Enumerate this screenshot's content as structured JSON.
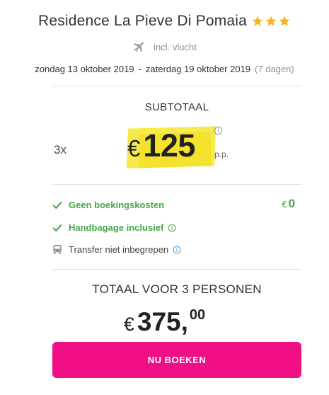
{
  "hotel": {
    "name": "Residence La Pieve Di Pomaia",
    "star_count": 3,
    "star_color": "#f6b526"
  },
  "flight": {
    "icon": "plane-icon",
    "text": "incl. vlucht"
  },
  "dates": {
    "start": "zondag 13 oktober 2019",
    "separator": "-",
    "end": "zaterdag 19 oktober 2019",
    "duration": "(7 dagen)"
  },
  "subtotal": {
    "label": "SUBTOTAAL",
    "count": "3x",
    "currency": "€",
    "price": "125",
    "per_person": "p.p.",
    "highlight_color": "#f7ea4b"
  },
  "features": [
    {
      "icon": "check-icon",
      "label": "Geen boekingskosten",
      "style": "green",
      "has_info": false
    },
    {
      "icon": "check-icon",
      "label": "Handbagage inclusief",
      "style": "green",
      "has_info": true
    },
    {
      "icon": "bus-icon",
      "label": "Transfer niet inbegrepen",
      "style": "plain",
      "has_info": true
    }
  ],
  "booking_fee": {
    "currency": "€",
    "amount": "0"
  },
  "total": {
    "label": "TOTAAL VOOR 3 PERSONEN",
    "currency": "€",
    "amount": "375,",
    "cents": "00"
  },
  "cta": {
    "label": "NU BOEKEN",
    "color": "#f10f85"
  },
  "colors": {
    "green": "#49a54a",
    "muted": "#8a8f96",
    "info_green": "#49a54a",
    "info_blue": "#3d9be0"
  }
}
